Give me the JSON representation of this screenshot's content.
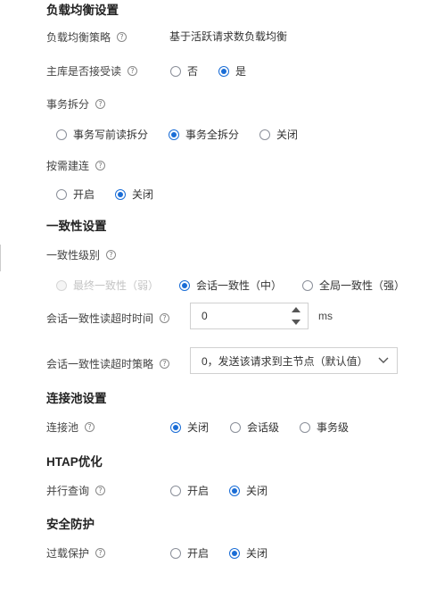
{
  "load_balancing": {
    "title": "负载均衡设置",
    "strategy_label": "负载均衡策略",
    "strategy_value": "基于活跃请求数负载均衡",
    "master_read_label": "主库是否接受读",
    "master_read_options": [
      {
        "label": "否",
        "checked": false
      },
      {
        "label": "是",
        "checked": true
      }
    ],
    "txn_split_label": "事务拆分",
    "txn_split_options": [
      {
        "label": "事务写前读拆分",
        "checked": false
      },
      {
        "label": "事务全拆分",
        "checked": true
      },
      {
        "label": "关闭",
        "checked": false
      }
    ],
    "on_demand_label": "按需建连",
    "on_demand_options": [
      {
        "label": "开启",
        "checked": false
      },
      {
        "label": "关闭",
        "checked": true
      }
    ]
  },
  "consistency": {
    "title": "一致性设置",
    "level_label": "一致性级别",
    "level_options": [
      {
        "label": "最终一致性（弱）",
        "checked": false,
        "disabled": true
      },
      {
        "label": "会话一致性（中）",
        "checked": true,
        "disabled": false
      },
      {
        "label": "全局一致性（强）",
        "checked": false,
        "disabled": false
      }
    ],
    "timeout_label": "会话一致性读超时时间",
    "timeout_value": "0",
    "timeout_unit": "ms",
    "timeout_policy_label": "会话一致性读超时策略",
    "timeout_policy_value": "0，发送该请求到主节点（默认值）"
  },
  "pool": {
    "title": "连接池设置",
    "label": "连接池",
    "options": [
      {
        "label": "关闭",
        "checked": true
      },
      {
        "label": "会话级",
        "checked": false
      },
      {
        "label": "事务级",
        "checked": false
      }
    ]
  },
  "htap": {
    "title": "HTAP优化",
    "label": "并行查询",
    "options": [
      {
        "label": "开启",
        "checked": false
      },
      {
        "label": "关闭",
        "checked": true
      }
    ]
  },
  "security": {
    "title": "安全防护",
    "label": "过载保护",
    "options": [
      {
        "label": "开启",
        "checked": false
      },
      {
        "label": "关闭",
        "checked": true
      }
    ]
  },
  "icons": {
    "help": "help-circle-icon",
    "select": "chevron-down-icon",
    "stepper": "stepper-arrows-icon"
  },
  "colors": {
    "accent": "#1a6dd6",
    "disabled": "#c4c4c4"
  }
}
